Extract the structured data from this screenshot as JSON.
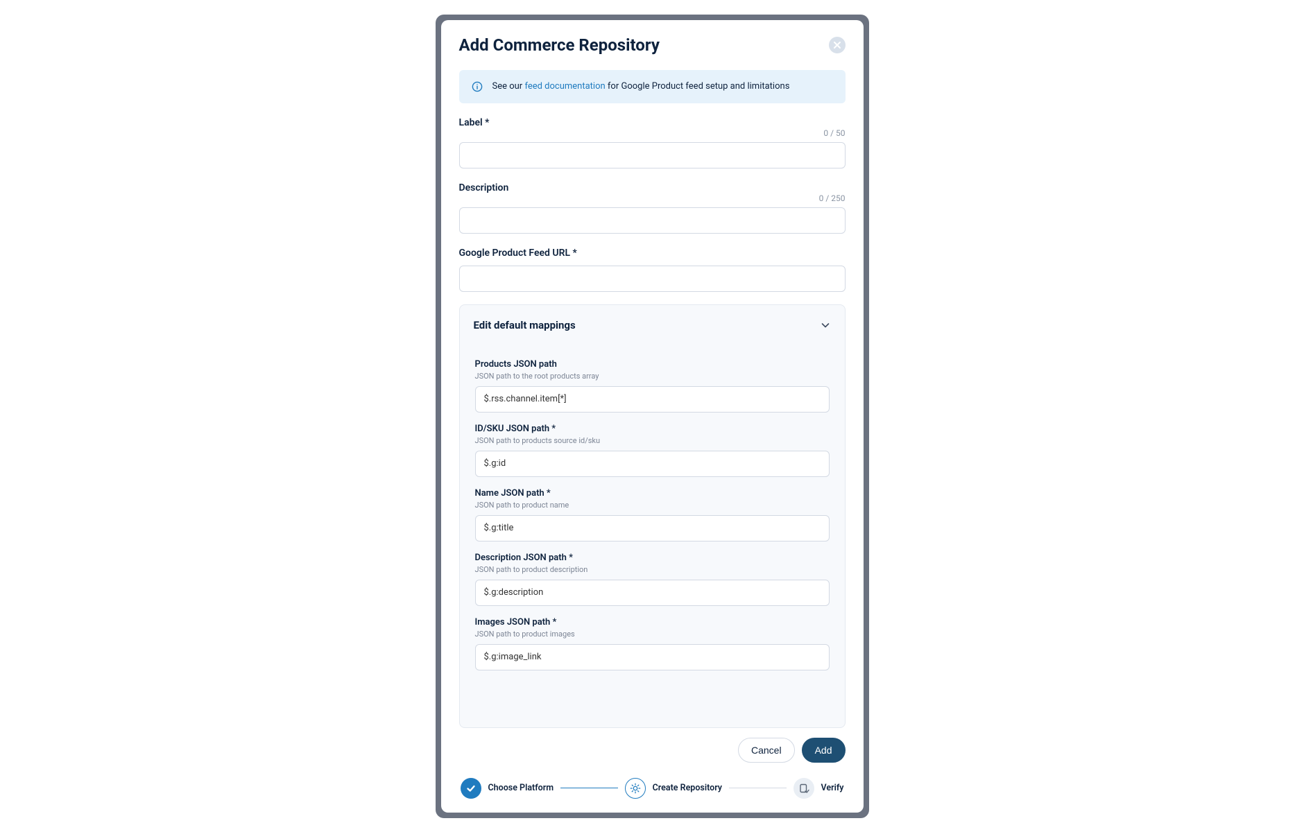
{
  "modal": {
    "title": "Add Commerce Repository",
    "info": {
      "prefix": "See our ",
      "link": "feed documentation",
      "suffix": " for Google Product feed setup and limitations"
    },
    "fields": {
      "label": {
        "label": "Label *",
        "counter": "0 / 50",
        "value": ""
      },
      "description": {
        "label": "Description",
        "counter": "0 / 250",
        "value": ""
      },
      "feedUrl": {
        "label": "Google Product Feed URL *",
        "value": ""
      }
    },
    "mappings": {
      "title": "Edit default mappings",
      "fields": [
        {
          "label": "Products JSON path",
          "hint": "JSON path to the root products array",
          "value": "$.rss.channel.item[*]"
        },
        {
          "label": "ID/SKU JSON path *",
          "hint": "JSON path to products source id/sku",
          "value": "$.g:id"
        },
        {
          "label": "Name JSON path *",
          "hint": "JSON path to product name",
          "value": "$.g:title"
        },
        {
          "label": "Description JSON path *",
          "hint": "JSON path to product description",
          "value": "$.g:description"
        },
        {
          "label": "Images JSON path *",
          "hint": "JSON path to product images",
          "value": "$.g:image_link"
        }
      ]
    },
    "actions": {
      "cancel": "Cancel",
      "add": "Add"
    },
    "stepper": {
      "step1": "Choose Platform",
      "step2": "Create Repository",
      "step3": "Verify"
    }
  }
}
